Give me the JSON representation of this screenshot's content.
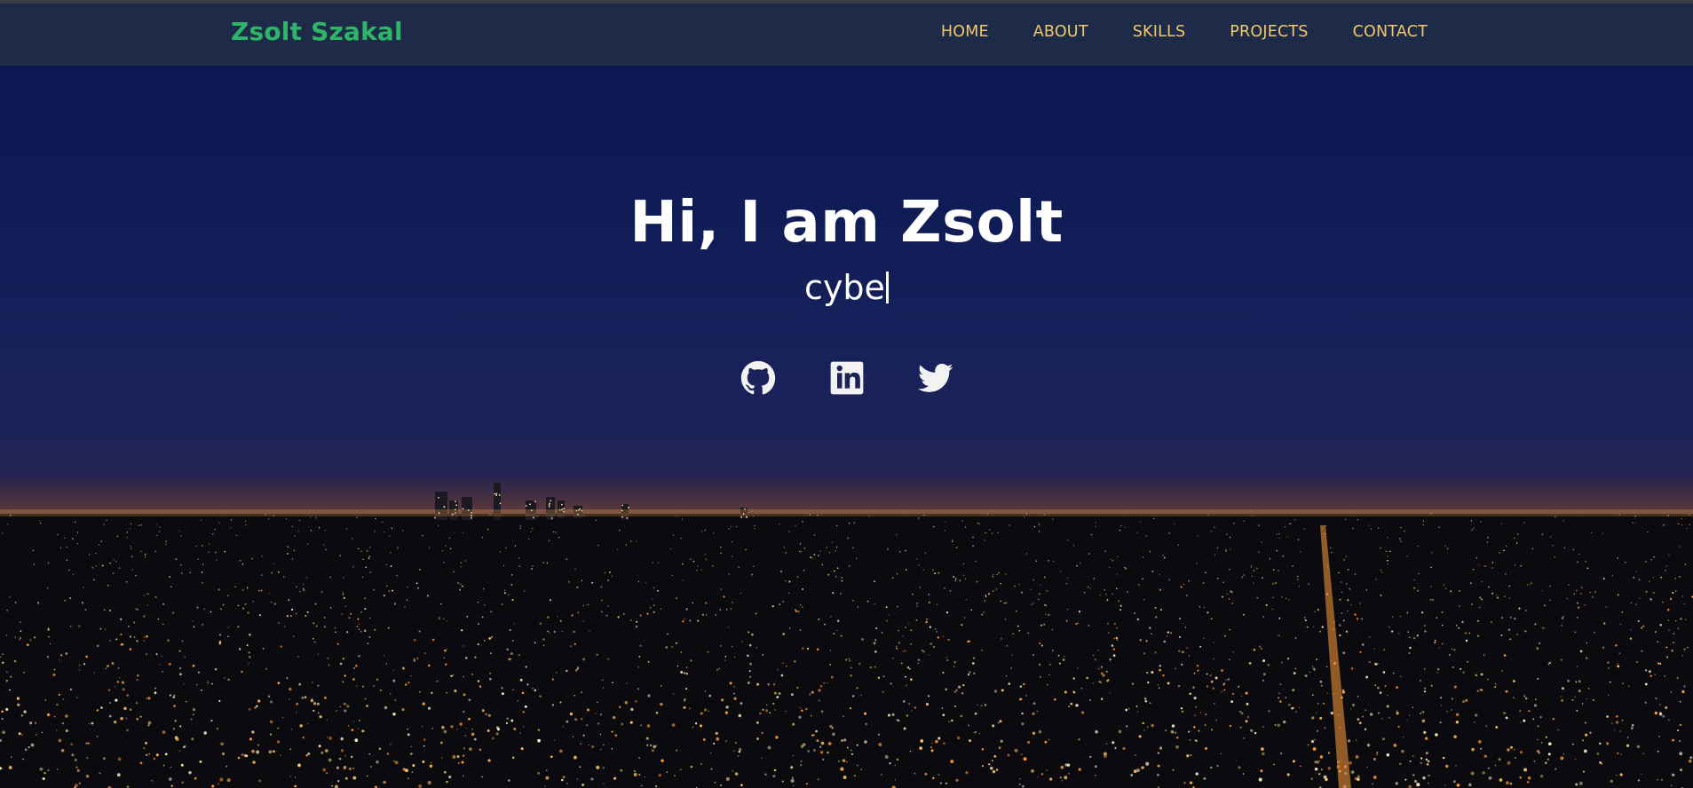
{
  "brand": "Zsolt Szakal",
  "nav": {
    "home": "HOME",
    "about": "ABOUT",
    "skills": "SKILLS",
    "projects": "PROJECTS",
    "contact": "CONTACT"
  },
  "hero": {
    "title": "Hi, I am Zsolt",
    "typed_text": "cybe"
  },
  "social": [
    "github-icon",
    "linkedin-icon",
    "twitter-icon"
  ],
  "colors": {
    "navbar_bg": "#1d2a48",
    "brand": "#2fb567",
    "nav_link": "#f1c86a",
    "hero_text": "#ffffff"
  }
}
